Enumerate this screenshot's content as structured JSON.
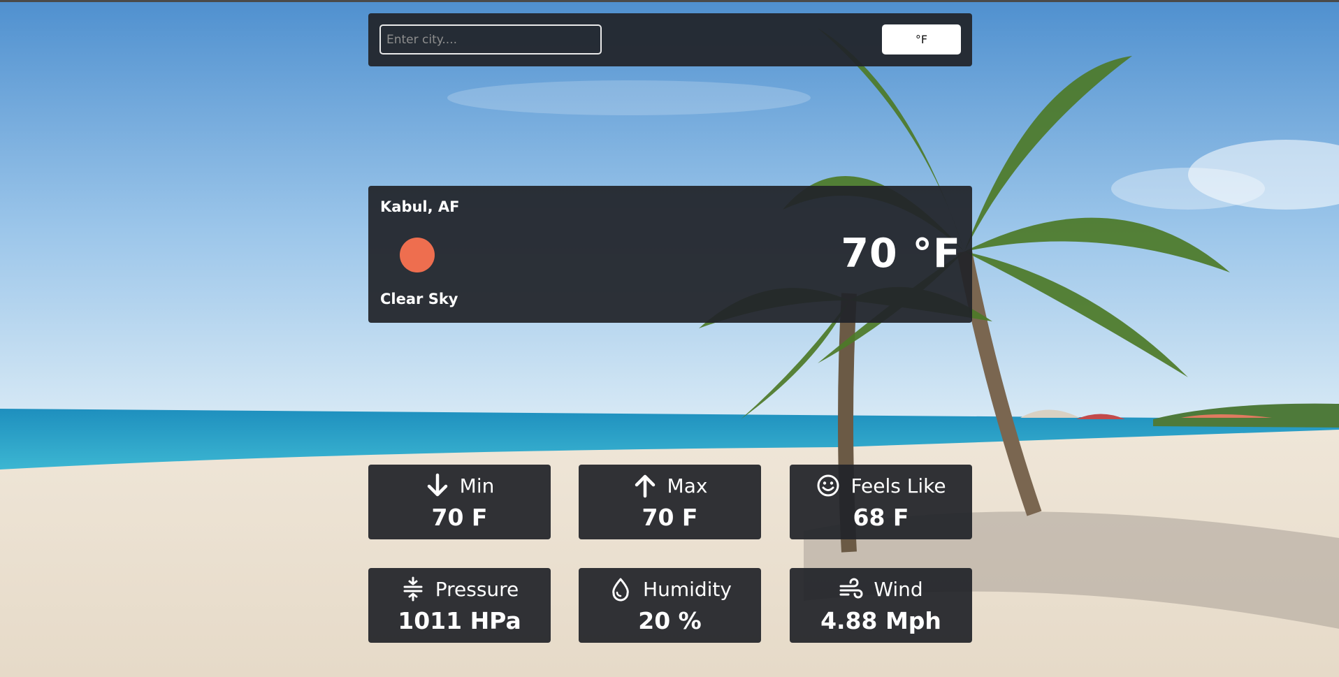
{
  "search": {
    "placeholder": "Enter city...."
  },
  "unit_toggle": {
    "label": "°F"
  },
  "current": {
    "location": "Kabul, AF",
    "condition": "Clear Sky",
    "temperature": "70 °F",
    "icon": "sun-icon",
    "icon_color": "#ee6e4f"
  },
  "stats": {
    "min": {
      "label": "Min",
      "value": "70 F",
      "icon": "arrow-down-icon"
    },
    "max": {
      "label": "Max",
      "value": "70 F",
      "icon": "arrow-up-icon"
    },
    "feels_like": {
      "label": "Feels Like",
      "value": "68 F",
      "icon": "smile-icon"
    },
    "pressure": {
      "label": "Pressure",
      "value": "1011 HPa",
      "icon": "compress-icon"
    },
    "humidity": {
      "label": "Humidity",
      "value": "20 %",
      "icon": "droplet-icon"
    },
    "wind": {
      "label": "Wind",
      "value": "4.88 Mph",
      "icon": "wind-icon"
    }
  },
  "colors": {
    "panel_bg": "#212429",
    "text": "#ffffff"
  }
}
